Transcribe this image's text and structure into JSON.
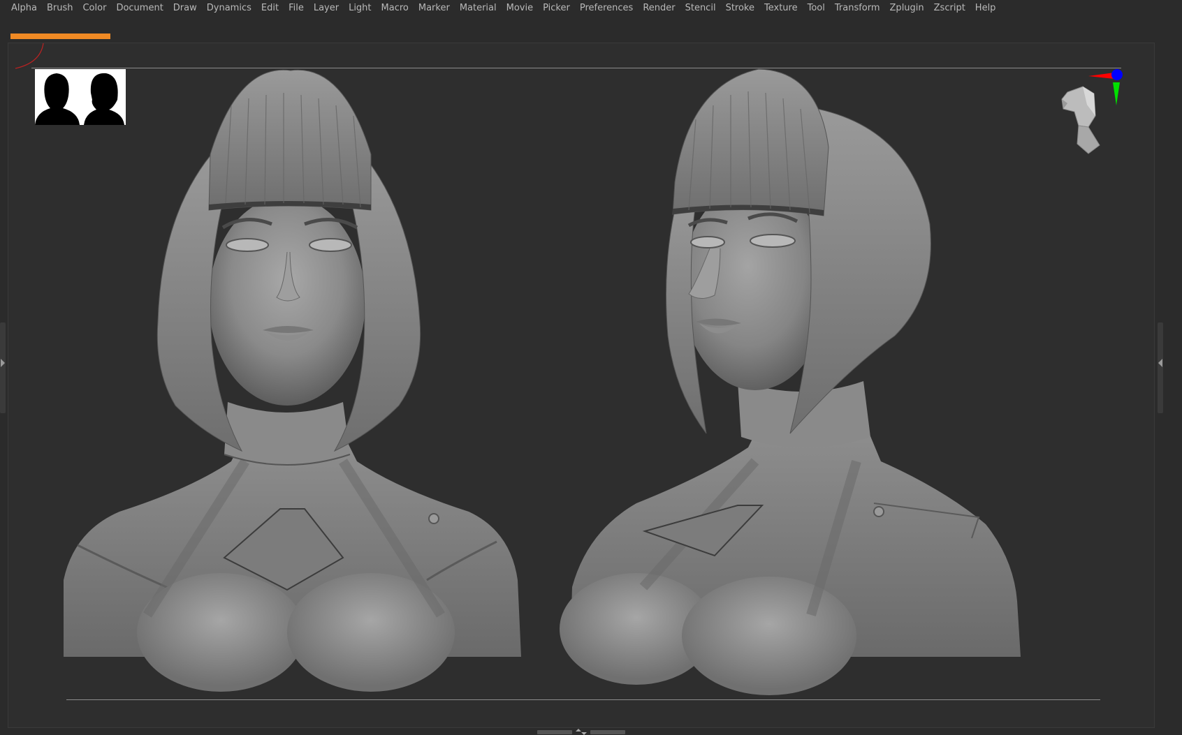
{
  "menu": {
    "items": [
      {
        "label": "Alpha"
      },
      {
        "label": "Brush"
      },
      {
        "label": "Color"
      },
      {
        "label": "Document"
      },
      {
        "label": "Draw"
      },
      {
        "label": "Dynamics"
      },
      {
        "label": "Edit"
      },
      {
        "label": "File"
      },
      {
        "label": "Layer"
      },
      {
        "label": "Light"
      },
      {
        "label": "Macro"
      },
      {
        "label": "Marker"
      },
      {
        "label": "Material"
      },
      {
        "label": "Movie"
      },
      {
        "label": "Picker"
      },
      {
        "label": "Preferences"
      },
      {
        "label": "Render"
      },
      {
        "label": "Stencil"
      },
      {
        "label": "Stroke"
      },
      {
        "label": "Texture"
      },
      {
        "label": "Tool"
      },
      {
        "label": "Transform"
      },
      {
        "label": "Zplugin"
      },
      {
        "label": "Zscript"
      },
      {
        "label": "Help"
      }
    ]
  },
  "progress": {
    "fraction": 1.0,
    "color": "#f08a24"
  },
  "colors": {
    "background": "#2b2b2b",
    "canvas": "#2e2e2e",
    "accent": "#f08a24",
    "axis_x": "#ff0000",
    "axis_y": "#00e000",
    "axis_z": "#0000ff",
    "clay": "#8a8a8a"
  },
  "icons": {
    "axis_gizmo": "xyz-axis-gizmo-icon",
    "nav_head": "navigation-head-icon",
    "silhouette": "silhouette-reference-icon"
  }
}
